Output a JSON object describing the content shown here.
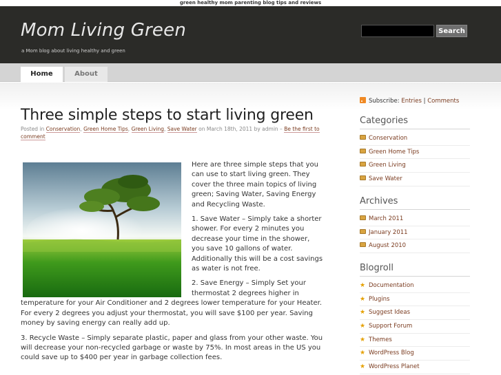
{
  "top_bar": {
    "text": "green healthy mom parenting blog tips and reviews"
  },
  "header": {
    "title": "Mom Living Green",
    "description": "a Mom blog about living healthy and green",
    "search_button": "Search"
  },
  "nav": {
    "tabs": [
      {
        "label": "Home"
      },
      {
        "label": "About"
      }
    ]
  },
  "post": {
    "title": "Three simple steps to start living green",
    "meta": {
      "posted_in": "Posted in",
      "categories": [
        "Conservation",
        "Green Home Tips",
        "Green Living",
        "Save Water"
      ],
      "date_text": "on March 18th, 2011 by admin –",
      "comment_link": "Be the first to comment"
    },
    "paragraphs": [
      "Here are three simple steps that you can use to start living green. They cover the three main topics of living green; Saving Water, Saving Energy and Recycling Waste.",
      "1. Save Water – Simply take a shorter shower. For every 2 minutes you decrease your time in the shower, you save 10 gallons of water. Additionally this will be a cost savings as water is not free.",
      "2. Save Energy – Simply Set your thermostat 2 degrees higher in temperature for your Air Conditioner and 2 degrees lower temperature for your Heater. For every 2 degrees you adjust your thermostat, you will save $100 per year. Saving money by saving energy can really add up.",
      "3. Recycle Waste – Simply separate plastic, paper and glass from your other waste. You will decrease your non-recycled garbage or waste by 75%. In most areas in the US you could save up to $400 per year in garbage collection fees."
    ]
  },
  "sidebar": {
    "subscribe": {
      "label": "Subscribe:",
      "entries": "Entries",
      "separator": "|",
      "comments": "Comments"
    },
    "categories": {
      "title": "Categories",
      "items": [
        "Conservation",
        "Green Home Tips",
        "Green Living",
        "Save Water"
      ]
    },
    "archives": {
      "title": "Archives",
      "items": [
        "March 2011",
        "January 2011",
        "August 2010"
      ]
    },
    "blogroll": {
      "title": "Blogroll",
      "items": [
        "Documentation",
        "Plugins",
        "Suggest Ideas",
        "Support Forum",
        "Themes",
        "WordPress Blog",
        "WordPress Planet"
      ]
    }
  },
  "colors": {
    "header_bg": "#2b2b28",
    "link": "#7a3b1f",
    "nav_bg": "#d4d4d4"
  }
}
